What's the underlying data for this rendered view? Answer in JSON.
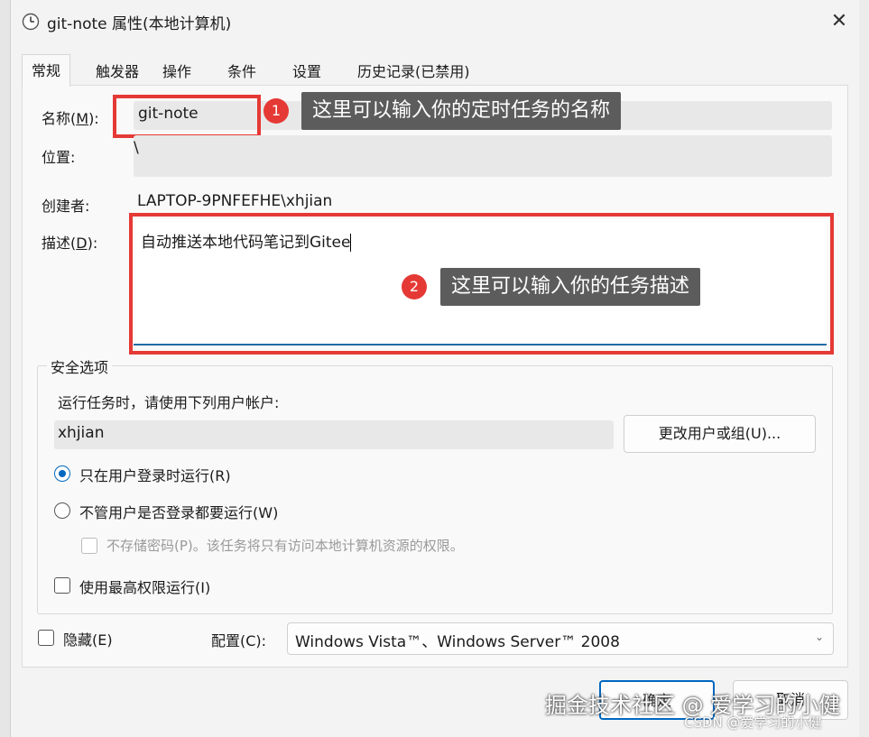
{
  "window": {
    "title": "git-note 属性(本地计算机)",
    "close_glyph": "✕"
  },
  "tabs": [
    {
      "label": "常规",
      "active": true
    },
    {
      "label": "触发器",
      "active": false
    },
    {
      "label": "操作",
      "active": false
    },
    {
      "label": "条件",
      "active": false
    },
    {
      "label": "设置",
      "active": false
    },
    {
      "label": "历史记录(已禁用)",
      "active": false
    }
  ],
  "general": {
    "name_label": "名称(",
    "name_hotkey": "M",
    "name_label_end": "):",
    "name_value": "git-note",
    "location_label": "位置:",
    "location_value": "\\",
    "author_label": "创建者:",
    "author_value": "LAPTOP-9PNFEFHE\\xhjian",
    "desc_label": "描述(",
    "desc_hotkey": "D",
    "desc_label_end": "):",
    "desc_value": "自动推送本地代码笔记到Gitee"
  },
  "annotations": [
    {
      "num": "1",
      "text": "这里可以输入你的定时任务的名称"
    },
    {
      "num": "2",
      "text": "这里可以输入你的任务描述"
    }
  ],
  "security": {
    "group_title": "安全选项",
    "run_as_label": "运行任务时，请使用下列用户帐户:",
    "user_value": "xhjian",
    "change_user_button": "更改用户或组(U)...",
    "radio_logged_on": "只在用户登录时运行(R)",
    "radio_logged_on_checked": true,
    "radio_whether": "不管用户是否登录都要运行(W)",
    "radio_whether_checked": false,
    "no_store_password": "不存储密码(P)。该任务将只有访问本地计算机资源的权限。",
    "highest_privileges": "使用最高权限运行(I)"
  },
  "footer": {
    "hidden_label": "隐藏(E)",
    "config_label": "配置(C):",
    "config_value": "Windows Vista™、Windows Server™ 2008",
    "ok_button": "确定",
    "cancel_button": "取消"
  },
  "watermark": {
    "main": "掘金技术社区 @ 爱学习的小健",
    "csdn": "CSDN @爱学习的小健"
  },
  "colors": {
    "accent": "#0067c0",
    "annotation_red": "#e53935",
    "callout_bg": "#5c5c5c"
  }
}
